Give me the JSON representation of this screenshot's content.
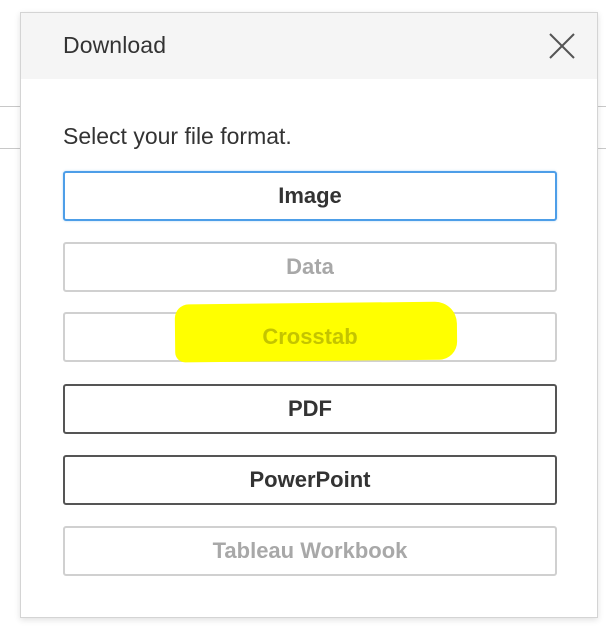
{
  "dialog": {
    "title": "Download",
    "prompt": "Select your file format."
  },
  "formats": [
    {
      "label": "Image",
      "state": "focused"
    },
    {
      "label": "Data",
      "state": "disabled"
    },
    {
      "label": "Crosstab",
      "state": "disabled",
      "highlighted": true
    },
    {
      "label": "PDF",
      "state": "enabled"
    },
    {
      "label": "PowerPoint",
      "state": "enabled"
    },
    {
      "label": "Tableau Workbook",
      "state": "disabled"
    }
  ],
  "icons": {
    "close": "close-x-icon"
  },
  "colors": {
    "header_bg": "#f5f5f5",
    "focus_border": "#4d9ee8",
    "enabled_border": "#555555",
    "disabled_border": "#d0d0d0",
    "disabled_text": "#a8a8a8",
    "highlight": "#ffff00"
  }
}
